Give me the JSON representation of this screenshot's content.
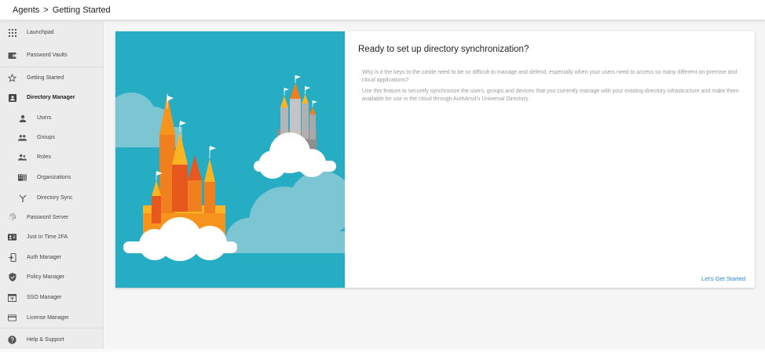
{
  "breadcrumb": {
    "parent": "Agents",
    "separator": ">",
    "current": "Getting Started"
  },
  "sidebar": {
    "items": [
      {
        "label": "Launchpad",
        "icon": "apps-grid-icon"
      },
      {
        "label": "Password Vaults",
        "icon": "wallet-icon"
      },
      {
        "label": "Getting Started",
        "icon": "star-icon"
      },
      {
        "label": "Directory Manager",
        "icon": "contact-card-icon"
      },
      {
        "label": "Users",
        "icon": "person-icon"
      },
      {
        "label": "Groups",
        "icon": "people-icon"
      },
      {
        "label": "Roles",
        "icon": "supervisor-icon"
      },
      {
        "label": "Organizations",
        "icon": "organization-icon"
      },
      {
        "label": "Directory Sync",
        "icon": "merge-icon"
      },
      {
        "label": "Password Server",
        "icon": "fingerprint-icon"
      },
      {
        "label": "Just In Time 2FA",
        "icon": "badge-icon"
      },
      {
        "label": "Auth Manager",
        "icon": "login-icon"
      },
      {
        "label": "Policy Manager",
        "icon": "shield-check-icon"
      },
      {
        "label": "SSO Manager",
        "icon": "sso-icon"
      },
      {
        "label": "License Manager",
        "icon": "credit-card-icon"
      },
      {
        "label": "Help & Support",
        "icon": "help-icon"
      }
    ]
  },
  "card": {
    "title": "Ready to set up directory synchronization?",
    "paragraph1": "Why is it the keys to the castle need to be so difficult to manage and defend, especially when your users need to access so many different on-premise and cloud applications?",
    "paragraph2": "Use this feature to securely synchronize the users, groups and devices that you currently manage with your existing directory infrastructure and make them available for use in the cloud through AuthAnvil's Universal Directory.",
    "cta": "Let's Get Started"
  },
  "colors": {
    "illustration_bg": "#26adc4",
    "accent_link": "#2a86d6",
    "castle_orange": "#f07f1e",
    "castle_yellow": "#fbb423",
    "castle_gray": "#9e9e9e"
  }
}
